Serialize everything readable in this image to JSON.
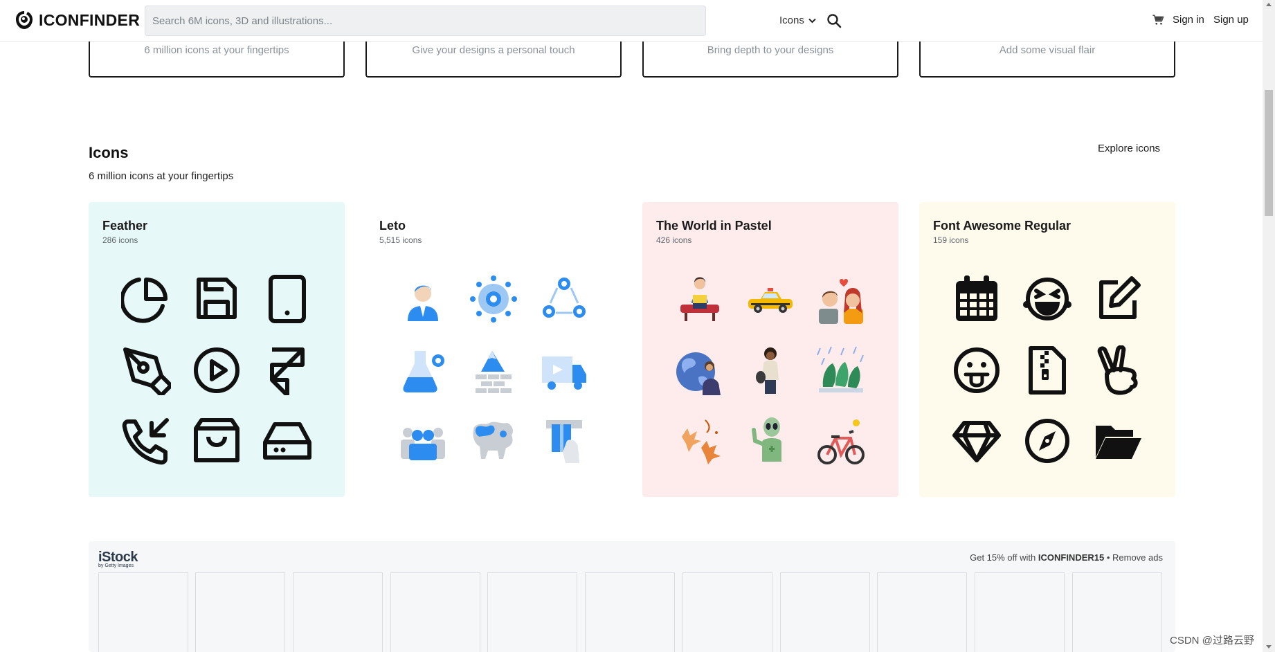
{
  "header": {
    "logo_text": "ICONFINDER",
    "search_placeholder": "Search 6M icons, 3D and illustrations...",
    "search_type": "Icons",
    "signin": "Sign in",
    "signup": "Sign up"
  },
  "top_cards": [
    {
      "subtitle": "6 million icons at your fingertips"
    },
    {
      "subtitle": "Give your designs a personal touch"
    },
    {
      "subtitle": "Bring depth to your designs"
    },
    {
      "subtitle": "Add some visual flair"
    }
  ],
  "icons_section": {
    "title": "Icons",
    "subtitle": "6 million icons at your fingertips",
    "explore": "Explore icons"
  },
  "icon_sets": [
    {
      "name": "Feather",
      "count": "286 icons",
      "bg": "#e6f9f8",
      "icons": [
        "pie-chart-icon",
        "save-icon",
        "tablet-icon",
        "pen-tool-icon",
        "play-circle-icon",
        "framer-icon",
        "phone-incoming-icon",
        "shopping-bag-icon",
        "hard-drive-icon"
      ]
    },
    {
      "name": "Leto",
      "count": "5,515 icons",
      "bg": "#ffffff",
      "icons": [
        "businessman-icon",
        "network-icon",
        "cycle-icon",
        "lab-flask-icon",
        "mountain-wall-icon",
        "video-truck-icon",
        "team-icon",
        "world-map-icon",
        "atm-card-icon"
      ]
    },
    {
      "name": "The World in Pastel",
      "count": "426 icons",
      "bg": "#fdeceb",
      "icons": [
        "reading-person-icon",
        "taxi-icon",
        "couple-love-icon",
        "refugee-world-icon",
        "traveler-woman-icon",
        "rainy-trees-icon",
        "autumn-leaves-icon",
        "alien-icon",
        "bicycle-icon"
      ]
    },
    {
      "name": "Font Awesome Regular",
      "count": "159 icons",
      "bg": "#fffbec",
      "icons": [
        "calendar-icon",
        "laugh-squint-icon",
        "edit-icon",
        "grin-tongue-icon",
        "file-archive-icon",
        "hand-peace-icon",
        "gem-icon",
        "compass-icon",
        "folder-open-icon"
      ]
    }
  ],
  "istock": {
    "logo": "iStock",
    "logo_sub": "by Getty Images",
    "promo_prefix": "Get 15% off with ",
    "promo_code": "ICONFINDER15",
    "promo_suffix": " • Remove ads"
  },
  "watermark": "CSDN @过路云野"
}
